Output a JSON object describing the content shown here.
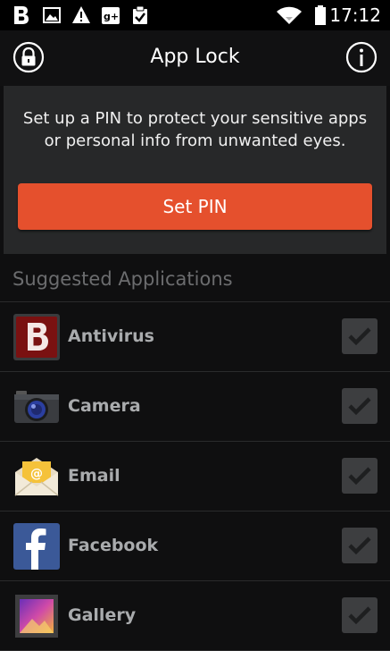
{
  "status_bar": {
    "time": "17:12",
    "icons": [
      "b-icon",
      "image-icon",
      "warning-icon",
      "google-plus-icon",
      "clipboard-check-icon",
      "wifi-icon",
      "battery-icon"
    ]
  },
  "action_bar": {
    "title": "App Lock",
    "left_icon": "lock-icon",
    "right_icon": "info-icon"
  },
  "pin_card": {
    "description": "Set up a PIN to protect your sensitive apps or personal info from unwanted eyes.",
    "button_label": "Set PIN",
    "button_color": "#e5502d"
  },
  "suggested": {
    "title": "Suggested Applications",
    "apps": [
      {
        "name": "Antivirus",
        "icon": "antivirus-icon",
        "checked": true
      },
      {
        "name": "Camera",
        "icon": "camera-icon",
        "checked": true
      },
      {
        "name": "Email",
        "icon": "email-icon",
        "checked": true
      },
      {
        "name": "Facebook",
        "icon": "facebook-icon",
        "checked": true
      },
      {
        "name": "Gallery",
        "icon": "gallery-icon",
        "checked": true
      }
    ]
  }
}
